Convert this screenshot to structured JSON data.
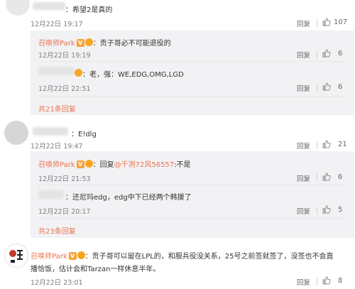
{
  "comments": [
    {
      "text": "：希望2是真的",
      "time": "12月22日 19:17",
      "reply_label": "回复",
      "likes": "107",
      "replies": [
        {
          "user": "召唤师Park",
          "text": "：贡子哥必不可能退役的",
          "time": "12月22日 19:19",
          "reply_label": "回复",
          "likes": "6"
        },
        {
          "text": "：老，强：WE,EDG,OMG,LGD",
          "time": "12月22日 22:51",
          "reply_label": "回复",
          "likes": "6"
        }
      ],
      "more": "共21条回复"
    },
    {
      "text": "：E!dlg",
      "time": "12月22日 19:47",
      "reply_label": "回复",
      "likes": "21",
      "replies": [
        {
          "user": "召唤师Park",
          "text_prefix": "：回复",
          "mention": "@千冽72风56557",
          "text_suffix": ":不是",
          "time": "12月22日 21:53",
          "reply_label": "回复",
          "likes": "6"
        },
        {
          "text": "：还尼玛edg，edg中下已经两个韩援了",
          "time": "12月22日 20:17",
          "reply_label": "回复",
          "likes": "5"
        }
      ],
      "more": "共23条回复"
    },
    {
      "user": "召唤师Park",
      "text_line1": "：贡子哥可以留在LPL的，和服兵役没关系，25号之前签就签了，没签也不会直",
      "text_line2": "播恰饭，估计会和Tarzan一样休息半年。",
      "time": "12月22日 23:01",
      "reply_label": "回复",
      "likes": "8"
    }
  ],
  "colors": {
    "accent": "#eb7350",
    "badge": "#f7a33a",
    "reply_bg": "#f2f2f5"
  }
}
